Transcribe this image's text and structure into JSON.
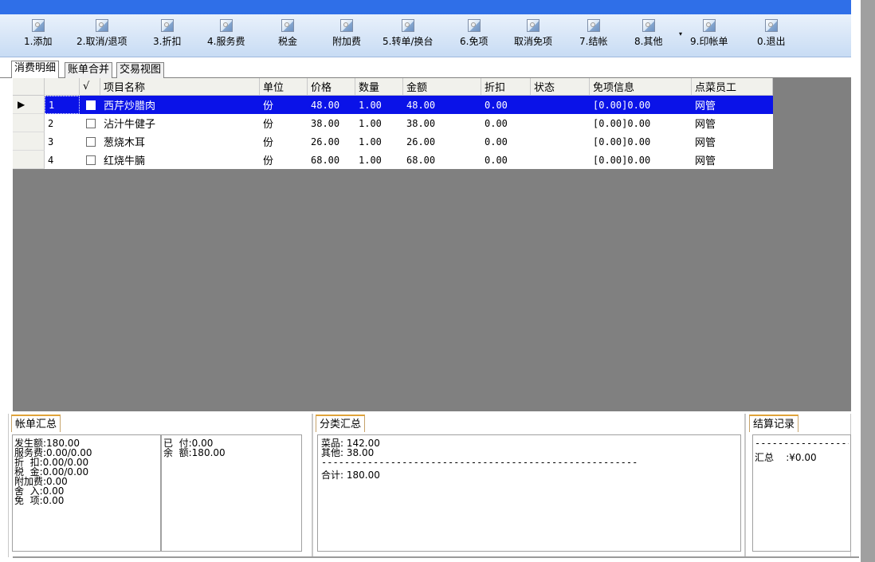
{
  "toolbar": {
    "buttons": [
      {
        "label": "1.添加"
      },
      {
        "label": "2.取消/退项"
      },
      {
        "label": "3.折扣"
      },
      {
        "label": "4.服务费"
      },
      {
        "label": "税金"
      },
      {
        "label": "附加费"
      },
      {
        "label": "5.转单/换台"
      },
      {
        "label": "6.免项"
      },
      {
        "label": "取消免项"
      },
      {
        "label": "7.结帐"
      },
      {
        "label": "8.其他"
      },
      {
        "label": "9.印帐单"
      },
      {
        "label": "0.退出"
      }
    ],
    "dropdown_glyph": "▾"
  },
  "tabs": [
    {
      "label": "消费明细"
    },
    {
      "label": "账单合并"
    },
    {
      "label": "交易视图"
    }
  ],
  "grid": {
    "columns": [
      "√",
      "项目名称",
      "单位",
      "价格",
      "数量",
      "金额",
      "折扣",
      "状态",
      "免项信息",
      "点菜员工"
    ],
    "rows": [
      {
        "no": "1",
        "name": "西芹炒腊肉",
        "unit": "份",
        "price": "48.00",
        "qty": "1.00",
        "amount": "48.00",
        "discount": "0.00",
        "status": "",
        "free": "[0.00]0.00",
        "staff": "网管"
      },
      {
        "no": "2",
        "name": "沾汁牛健子",
        "unit": "份",
        "price": "38.00",
        "qty": "1.00",
        "amount": "38.00",
        "discount": "0.00",
        "status": "",
        "free": "[0.00]0.00",
        "staff": "网管"
      },
      {
        "no": "3",
        "name": "葱烧木耳",
        "unit": "份",
        "price": "26.00",
        "qty": "1.00",
        "amount": "26.00",
        "discount": "0.00",
        "status": "",
        "free": "[0.00]0.00",
        "staff": "网管"
      },
      {
        "no": "4",
        "name": "红烧牛腩",
        "unit": "份",
        "price": "68.00",
        "qty": "1.00",
        "amount": "68.00",
        "discount": "0.00",
        "status": "",
        "free": "[0.00]0.00",
        "staff": "网管"
      }
    ],
    "selected_marker": "▶"
  },
  "bill_summary": {
    "title": "帐单汇总",
    "left_lines": [
      "发生额:180.00",
      "服务费:0.00/0.00",
      "折  扣:0.00/0.00",
      "税  金:0.00/0.00",
      "附加费:0.00",
      "舍  入:0.00",
      "免  项:0.00"
    ],
    "right_lines": [
      "已  付:0.00",
      "余  额:180.00"
    ]
  },
  "category_summary": {
    "title": "分类汇总",
    "lines": [
      "菜品: 142.00",
      "其他: 38.00",
      "--------------------------------------------------------",
      "合计: 180.00"
    ]
  },
  "settle_record": {
    "title": "结算记录",
    "lines": [
      "------------------",
      "汇总    :¥0.00"
    ]
  },
  "colors": {
    "title_strip": "#2f6fe8",
    "selected_row": "#0a12e8",
    "grid_background": "#808080",
    "panel_tab_accent": "#e0a33a"
  }
}
